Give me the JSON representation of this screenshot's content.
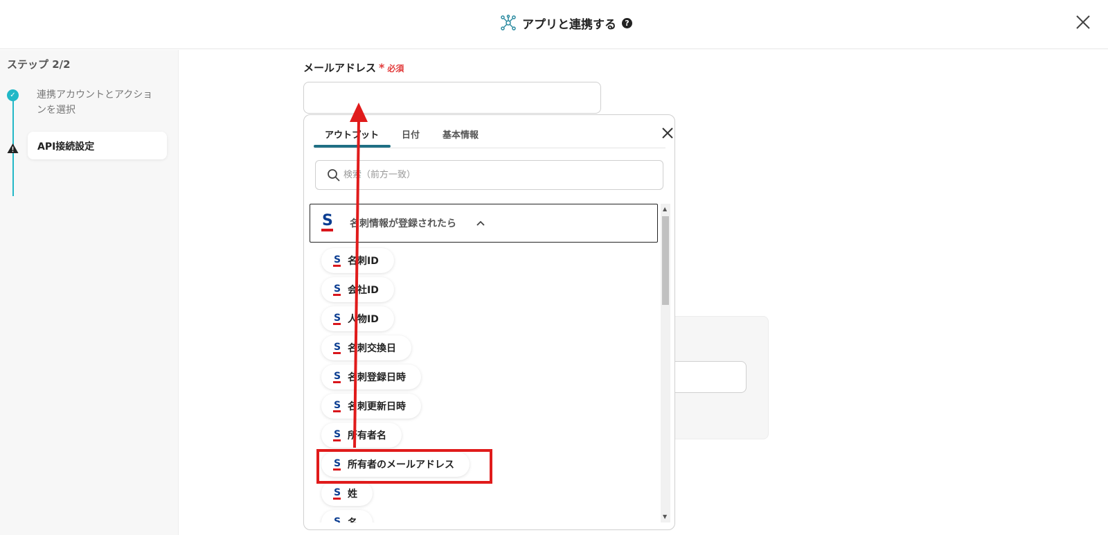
{
  "header": {
    "title": "アプリと連携する",
    "help": "?"
  },
  "sidebar": {
    "step_title": "ステップ 2/2",
    "steps": [
      {
        "label": "連携アカウントとアクションを選択",
        "status": "done"
      },
      {
        "label": "API接続設定",
        "status": "warning"
      }
    ]
  },
  "form": {
    "email_label": "メールアドレス",
    "required_mark": "*",
    "required_text": "必須",
    "email_value": ""
  },
  "popup": {
    "tabs": [
      {
        "label": "アウトプット",
        "active": true
      },
      {
        "label": "日付",
        "active": false
      },
      {
        "label": "基本情報",
        "active": false
      }
    ],
    "search_placeholder": "検索（前方一致）",
    "group_title": "名刺情報が登録されたら",
    "items": [
      "名刺ID",
      "会社ID",
      "人物ID",
      "名刺交換日",
      "名刺登録日時",
      "名刺更新日時",
      "所有者名",
      "所有者のメールアドレス",
      "姓",
      "名"
    ],
    "highlighted_item": "所有者のメールアドレス"
  },
  "colors": {
    "accent": "#21b8c7",
    "tab_underline": "#1f6f84",
    "annotation": "#e01b1b",
    "logo_blue": "#0b3d91",
    "logo_red": "#d9161c"
  }
}
